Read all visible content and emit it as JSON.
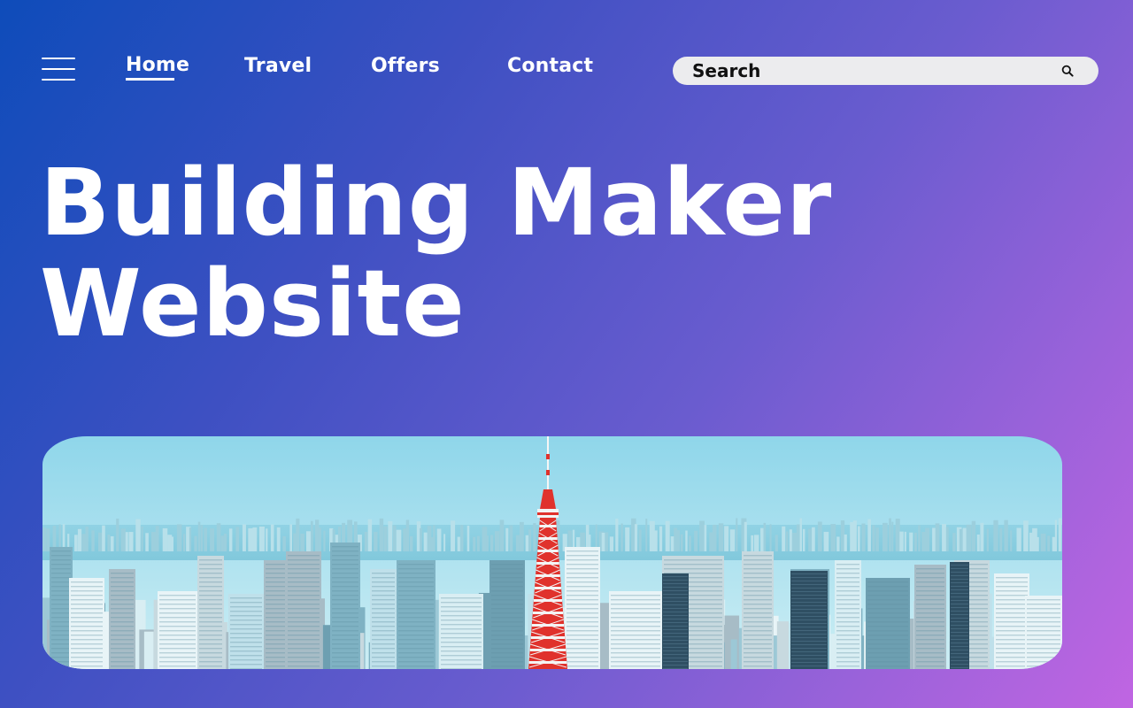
{
  "nav": {
    "menu_icon": "hamburger-menu-icon",
    "links": [
      {
        "label": "Home",
        "active": true
      },
      {
        "label": "Travel",
        "active": false
      },
      {
        "label": "Offers",
        "active": false
      },
      {
        "label": "Contact",
        "active": false
      }
    ]
  },
  "search": {
    "placeholder": "Search",
    "icon": "search-icon"
  },
  "hero": {
    "title_line1": "Building Maker",
    "title_line2": "Website"
  },
  "image": {
    "subject": "city-skyline-with-red-white-tower"
  },
  "colors": {
    "gradient_start": "#0e4cba",
    "gradient_end": "#c065e2",
    "text": "#ffffff",
    "search_bg": "#ececee",
    "tower_red": "#e0322c"
  }
}
